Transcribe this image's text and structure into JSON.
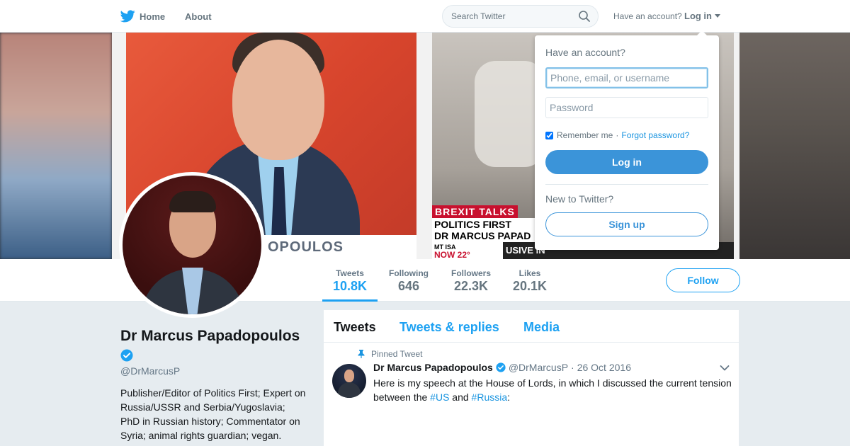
{
  "nav": {
    "home_label": "Home",
    "about_label": "About",
    "search_placeholder": "Search Twitter",
    "have_account_text": "Have an account?",
    "login_label": "Log in",
    "brand_color": "#1da1f2"
  },
  "banner": {
    "caption_name": "OPOULOS",
    "ticker_topic": "BREXIT TALKS",
    "ticker_line1": "POLITICS FIRST",
    "ticker_line2": "DR MARCUS PAPAD",
    "ticker_location": "MT ISA",
    "ticker_weather": "NOW 22°",
    "ticker_live": "USIVE IN"
  },
  "stats": [
    {
      "label": "Tweets",
      "value": "10.8K",
      "active": true
    },
    {
      "label": "Following",
      "value": "646",
      "active": false
    },
    {
      "label": "Followers",
      "value": "22.3K",
      "active": false
    },
    {
      "label": "Likes",
      "value": "20.1K",
      "active": false
    }
  ],
  "follow_label": "Follow",
  "profile": {
    "name": "Dr Marcus Papadopoulos",
    "verified": true,
    "handle": "@DrMarcusP",
    "bio": "Publisher/Editor of Politics First; Expert on Russia/USSR and Serbia/Yugoslavia; PhD in Russian history; Commentator on Syria; animal rights guardian; vegan."
  },
  "timeline": {
    "tabs": [
      "Tweets",
      "Tweets & replies",
      "Media"
    ],
    "pinned_label": "Pinned Tweet",
    "tweet": {
      "fullname": "Dr Marcus Papadopoulos",
      "username": "@DrMarcusP",
      "separator": "·",
      "time": "26 Oct 2016",
      "text_part1": "Here is my speech at the House of Lords, in which I discussed the current tension between the ",
      "hashtag1": "#US",
      "text_part2": " and ",
      "hashtag2": "#Russia",
      "text_part3": ":"
    }
  },
  "login_dropdown": {
    "title": "Have an account?",
    "username_placeholder": "Phone, email, or username",
    "password_placeholder": "Password",
    "remember_label": "Remember me",
    "remember_separator": "·",
    "forgot_label": "Forgot password?",
    "remember_checked": true,
    "login_button": "Log in",
    "new_prompt": "New to Twitter?",
    "signup_button": "Sign up"
  }
}
